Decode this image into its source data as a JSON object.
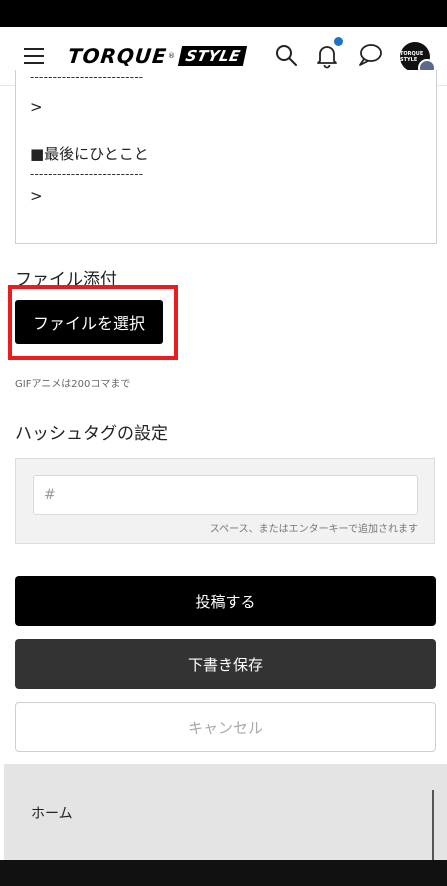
{
  "header": {
    "logo_main": "TORQUE",
    "logo_reg": "®",
    "logo_sub": "STYLE",
    "icons": [
      "hamburger-icon",
      "search-icon",
      "bell-icon",
      "chat-icon",
      "avatar"
    ],
    "notification_dot_color": "#1a73c8"
  },
  "editor": {
    "lines": [
      ">",
      "■最後にひとこと",
      ">"
    ],
    "divider": "-------------------------"
  },
  "attachment": {
    "label": "ファイル添付",
    "button_label": "ファイルを選択",
    "hint": "GIFアニメは200コマまで",
    "highlight_color": "#ec1c1c"
  },
  "hashtag": {
    "label": "ハッシュタグの設定",
    "placeholder": "#",
    "help": "スペース、またはエンターキーで追加されます"
  },
  "actions": {
    "post": "投稿する",
    "draft": "下書き保存",
    "cancel": "キャンセル"
  },
  "footer": {
    "home": "ホーム"
  },
  "avatar": {
    "text": "TORQUE STYLE"
  }
}
